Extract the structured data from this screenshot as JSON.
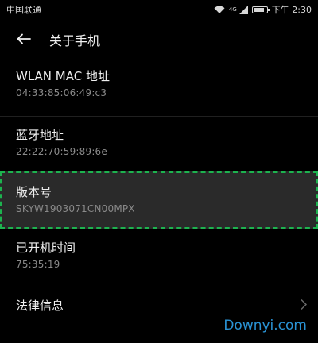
{
  "status_bar": {
    "carrier": "中国联通",
    "network_type": "4G",
    "time": "下午 2:30",
    "battery_level": 0.8,
    "icons": [
      "wifi-icon",
      "signal-icon",
      "battery-icon"
    ]
  },
  "header": {
    "back_icon": "arrow-left-icon",
    "title": "关于手机"
  },
  "items": [
    {
      "label": "WLAN MAC 地址",
      "value": "04:33:85:06:49:c3"
    },
    {
      "label": "蓝牙地址",
      "value": "22:22:70:59:89:6e"
    },
    {
      "label": "版本号",
      "value": "SKYW1903071CN00MPX",
      "highlighted": true
    },
    {
      "label": "已开机时间",
      "value": "75:35:19"
    },
    {
      "label": "法律信息",
      "chevron": "chevron-right-icon"
    }
  ],
  "watermark": "Downyi.com",
  "colors": {
    "background": "#000000",
    "highlight_border": "#1db34f",
    "highlight_bg": "#2a2a2a",
    "watermark": "#2a93d5"
  }
}
